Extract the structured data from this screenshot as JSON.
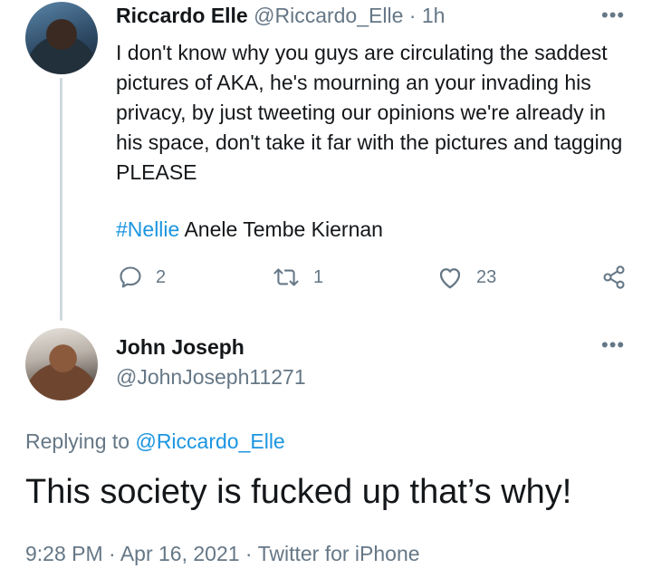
{
  "tweet1": {
    "author_name": "Riccardo Elle",
    "handle": "@Riccardo_Elle",
    "separator": "·",
    "time": "1h",
    "more": "•••",
    "body": "I don't know why you guys are circulating the saddest pictures of AKA, he's mourning an your invading his privacy, by just tweeting our opinions we're already in his space, don't take it far with the pictures and tagging PLEASE",
    "hashtag": "#Nellie",
    "tag_text": " Anele Tembe Kiernan",
    "reply_count": "2",
    "retweet_count": "1",
    "like_count": "23",
    "icons": [
      "reply-icon",
      "retweet-icon",
      "like-icon",
      "share-icon"
    ]
  },
  "tweet2": {
    "author_name": "John Joseph",
    "handle": "@JohnJoseph11271",
    "more": "•••",
    "replying_prefix": "Replying to ",
    "replying_to": "@Riccardo_Elle",
    "text": "This society is fucked up that’s why!",
    "time": "9:28 PM",
    "sep1": " · ",
    "date": "Apr 16, 2021",
    "sep2": " · ",
    "source": "Twitter for iPhone"
  },
  "colors": {
    "text": "#14171a",
    "muted": "#657786",
    "link": "#1b95e0",
    "thread_line": "#cfd9de"
  }
}
